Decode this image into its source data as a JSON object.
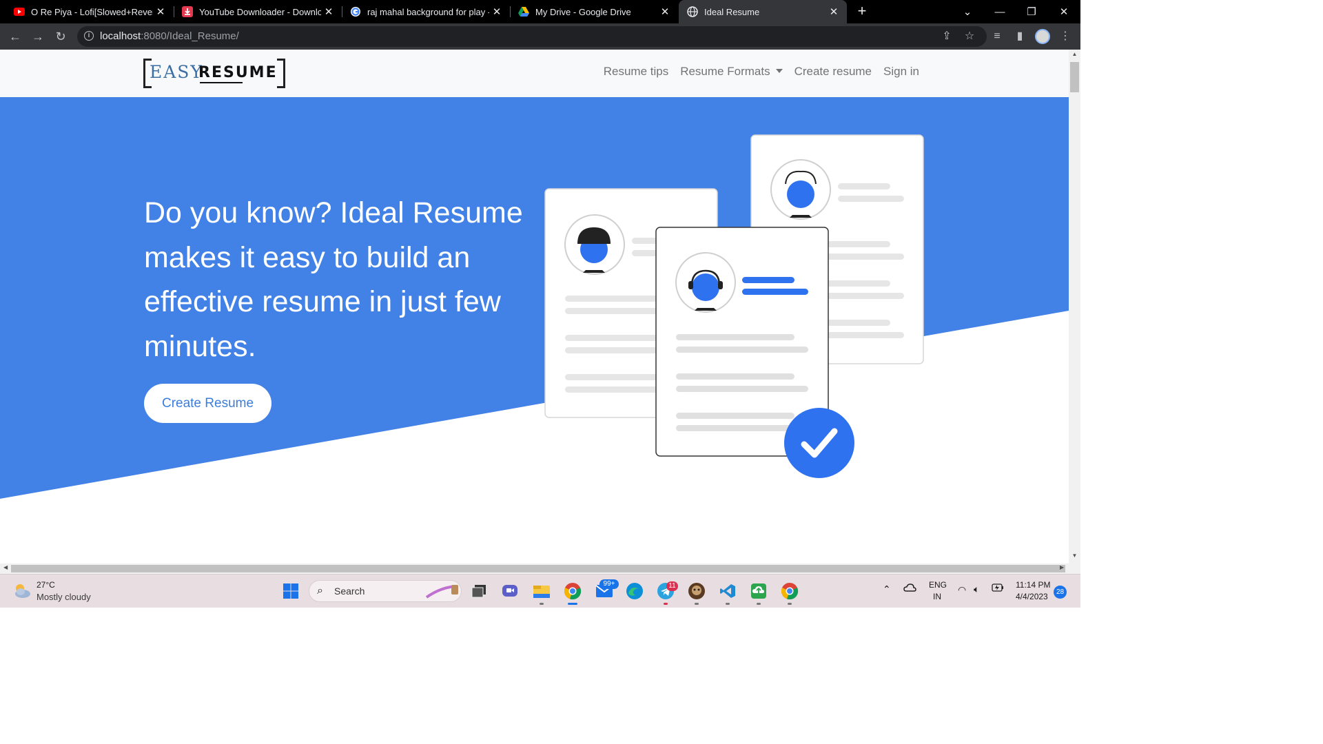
{
  "browser": {
    "tabs": [
      {
        "title": "O Re Piya - Lofi[Slowed+Reverb]",
        "icon": "youtube-icon"
      },
      {
        "title": "YouTube Downloader - Download",
        "icon": "download-icon"
      },
      {
        "title": "raj mahal background for play -",
        "icon": "google-icon"
      },
      {
        "title": "My Drive - Google Drive",
        "icon": "google-drive-icon"
      },
      {
        "title": "Ideal Resume",
        "icon": "globe-icon",
        "active": true
      }
    ],
    "url_host": "localhost",
    "url_path": ":8080/Ideal_Resume/"
  },
  "site": {
    "logo_easy": "EASY",
    "logo_resume": "RESUME",
    "nav": [
      "Resume tips",
      "Resume Formats",
      "Create resume",
      "Sign in"
    ],
    "headline": "Do you know? Ideal Resume makes it easy to build an effective resume in just few minutes.",
    "cta": "Create Resume"
  },
  "colors": {
    "hero_blue": "#4281e6",
    "accent_blue": "#2f72f0"
  },
  "taskbar": {
    "temperature": "27°C",
    "weather": "Mostly cloudy",
    "search_placeholder": "Search",
    "mail_badge": "99+",
    "telegram_badge": "11",
    "language_1": "ENG",
    "language_2": "IN",
    "time": "11:14 PM",
    "date": "4/4/2023",
    "notification_count": "28"
  }
}
